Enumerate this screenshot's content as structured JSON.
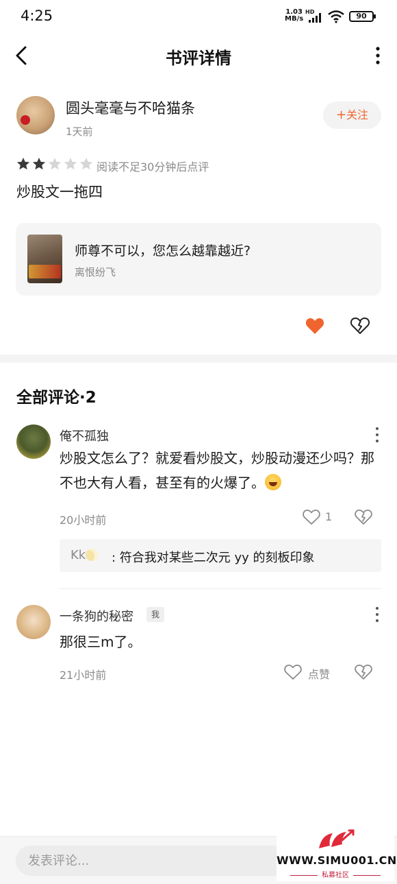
{
  "status_bar": {
    "time": "4:25",
    "net_speed_value": "1.03",
    "net_speed_unit": "MB/s",
    "network_label": "HD",
    "battery": "90"
  },
  "header": {
    "title": "书评详情"
  },
  "review": {
    "author_name": "圆头毫毫与不哈猫条",
    "posted_time": "1天前",
    "follow_label": "关注",
    "rating": 2,
    "rating_max": 5,
    "rating_note": "阅读不足30分钟后点评",
    "text": "炒股文一拖四",
    "book": {
      "title": "师尊不可以，您怎么越靠越近?",
      "author": "离恨纷飞"
    },
    "liked": true
  },
  "comments_section": {
    "header": "全部评论·2"
  },
  "comments": [
    {
      "user": "俺不孤独",
      "text": "炒股文怎么了？就爱看炒股文，炒股动漫还少吗？那不也大有人看，甚至有的火爆了。",
      "time": "20小时前",
      "likes": "1",
      "reply": {
        "user": "Kk",
        "text": ": 符合我对某些二次元 yy 的刻板印象"
      }
    },
    {
      "user": "一条狗的秘密",
      "badge": "我",
      "text": "那很三m了。",
      "time": "21小时前",
      "likes_label": "点赞"
    }
  ],
  "bottom_bar": {
    "placeholder": "发表评论..."
  },
  "watermark": {
    "site": "WWW.SIMU001.CN",
    "sub": "私募社区"
  },
  "colors": {
    "accent": "#f0652f",
    "text_primary": "#1a1a1a",
    "text_secondary": "#8a8a8a",
    "card_bg": "#f5f5f5"
  }
}
